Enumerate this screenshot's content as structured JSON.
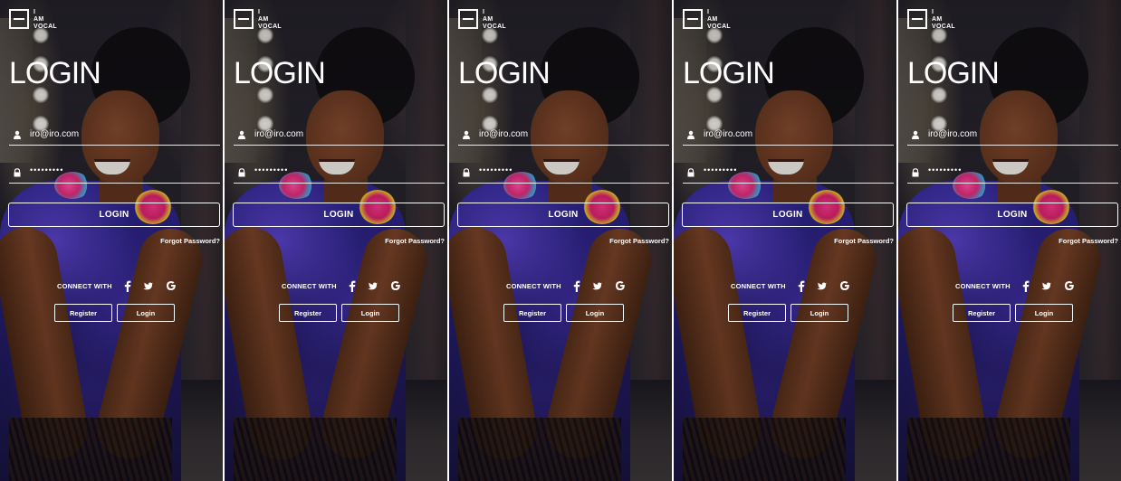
{
  "brand": {
    "logo_lines": [
      "I",
      "AM",
      "VOCAL"
    ]
  },
  "screen": {
    "title": "LOGIN",
    "email_value": "iro@iro.com",
    "password_value": "•••••••••",
    "login_button": "LOGIN",
    "forgot_password": "Forgot Password?",
    "connect_with": "CONNECT WITH",
    "social_icons": [
      "facebook-icon",
      "twitter-icon",
      "google-icon"
    ],
    "register_button": "Register",
    "login_small_button": "Login"
  },
  "panel_count": 5,
  "colors": {
    "text": "#ffffff",
    "accent_dress": "#2e2590",
    "earring": "#e02b7a"
  }
}
